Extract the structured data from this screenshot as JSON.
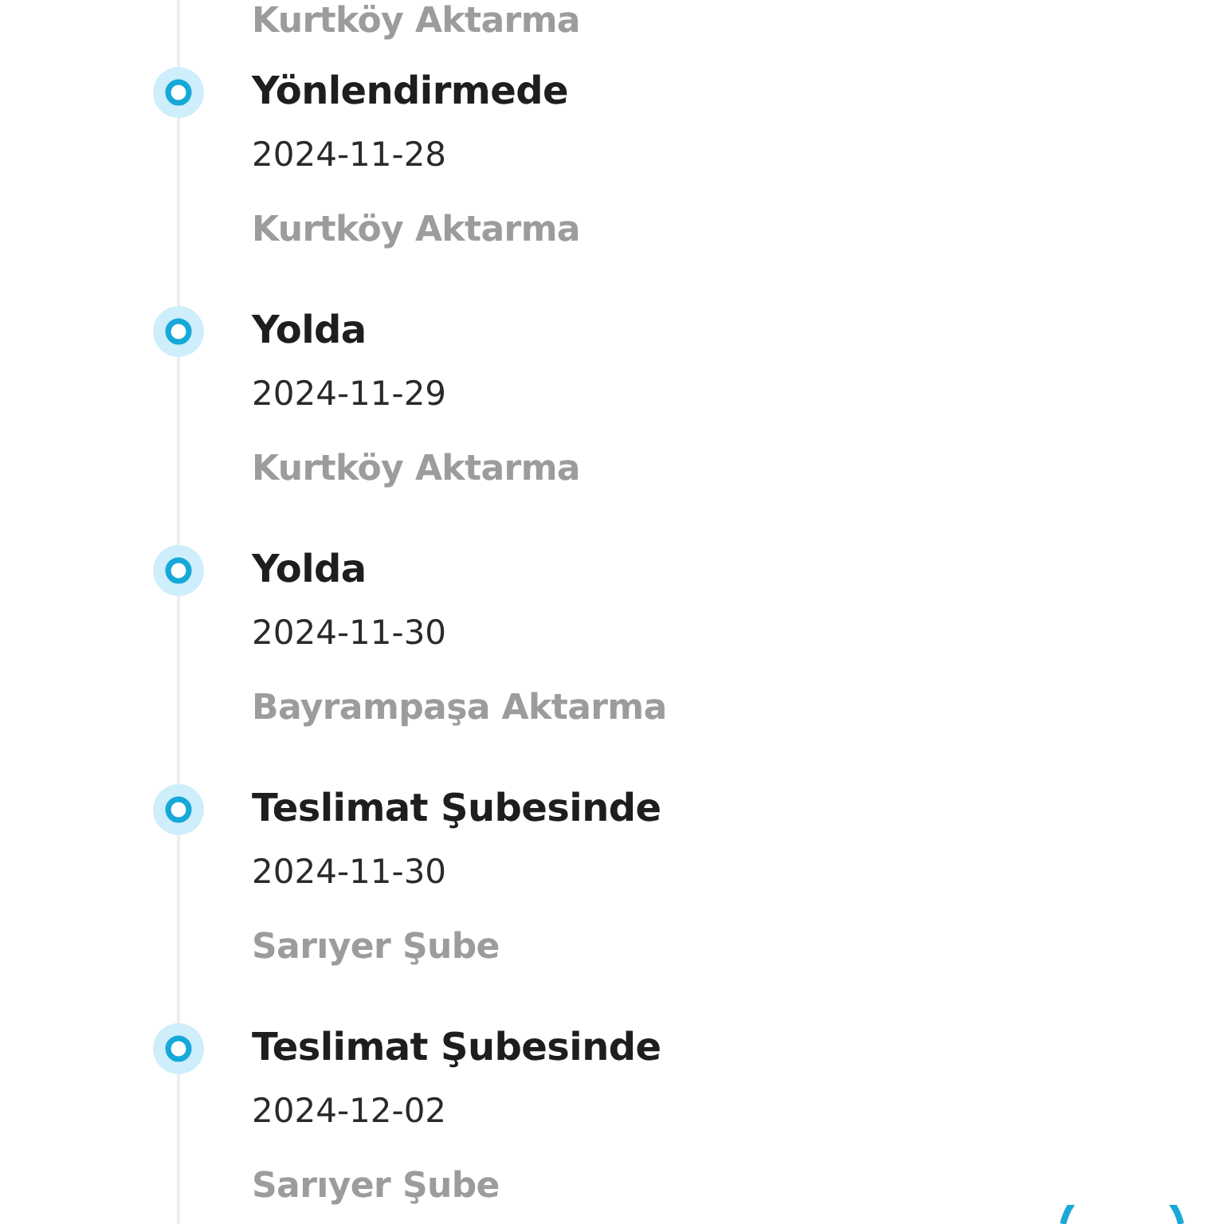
{
  "previous_location": "Kurtköy Aktarma",
  "events": [
    {
      "status": "Yönlendirmede",
      "date": "2024-11-28",
      "location": "Kurtköy Aktarma"
    },
    {
      "status": "Yolda",
      "date": "2024-11-29",
      "location": "Kurtköy Aktarma"
    },
    {
      "status": "Yolda",
      "date": "2024-11-30",
      "location": "Bayrampaşa Aktarma"
    },
    {
      "status": "Teslimat Şubesinde",
      "date": "2024-11-30",
      "location": "Sarıyer Şube"
    },
    {
      "status": "Teslimat Şubesinde",
      "date": "2024-12-02",
      "location": "Sarıyer Şube"
    }
  ]
}
